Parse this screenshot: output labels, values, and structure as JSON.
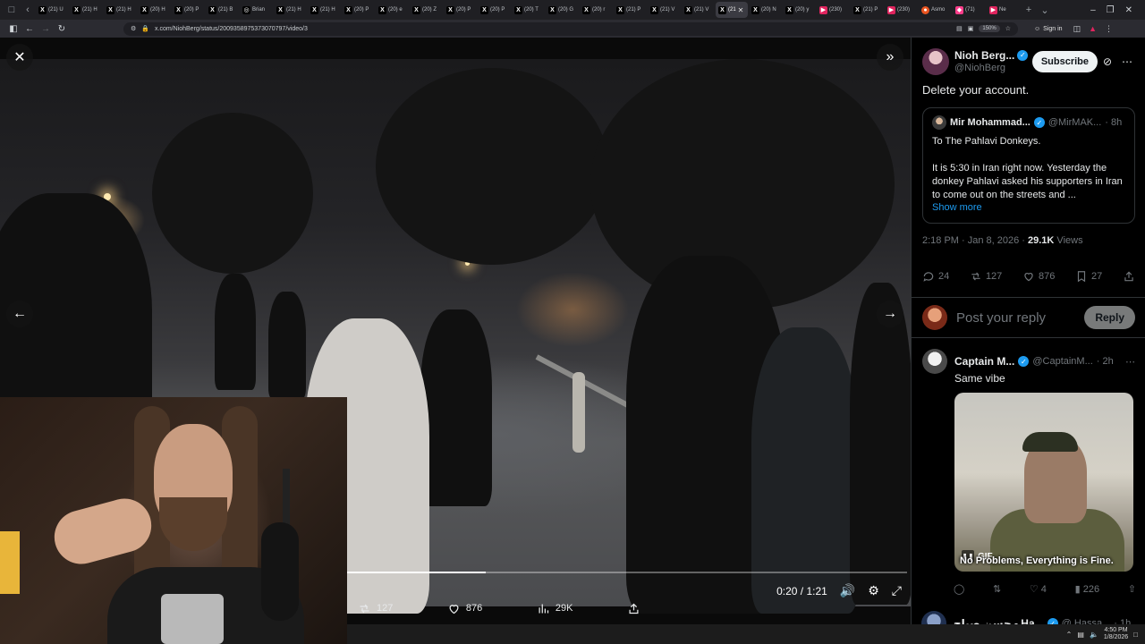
{
  "browser": {
    "tabs": [
      {
        "icon": "x-logo",
        "label": "(21) U"
      },
      {
        "icon": "x-logo",
        "label": "(21) H"
      },
      {
        "icon": "x-logo",
        "label": "(21) H"
      },
      {
        "icon": "x-logo",
        "label": "(20) H"
      },
      {
        "icon": "x-logo",
        "label": "(20) P"
      },
      {
        "icon": "x-logo",
        "label": "(21) B"
      },
      {
        "icon": "circle-logo",
        "label": "Brian"
      },
      {
        "icon": "x-logo",
        "label": "(21) H"
      },
      {
        "icon": "x-logo",
        "label": "(21) H"
      },
      {
        "icon": "x-logo",
        "label": "(20) P"
      },
      {
        "icon": "x-logo",
        "label": "(20) e"
      },
      {
        "icon": "x-logo",
        "label": "(20) Z"
      },
      {
        "icon": "x-logo",
        "label": "(20) P"
      },
      {
        "icon": "x-logo",
        "label": "(20) P"
      },
      {
        "icon": "x-logo",
        "label": "(20) T"
      },
      {
        "icon": "x-logo",
        "label": "(20) G"
      },
      {
        "icon": "x-logo",
        "label": "(20) r"
      },
      {
        "icon": "x-logo",
        "label": "(21) P"
      },
      {
        "icon": "x-logo",
        "label": "(21) V"
      },
      {
        "icon": "x-logo",
        "label": "(21) V"
      },
      {
        "icon": "x-logo",
        "label": "(21",
        "active": true
      },
      {
        "icon": "x-logo",
        "label": "(20) N"
      },
      {
        "icon": "x-logo",
        "label": "(20) y"
      },
      {
        "icon": "youtube-logo",
        "label": "(230)"
      },
      {
        "icon": "x-logo",
        "label": "(21) P"
      },
      {
        "icon": "youtube-logo",
        "label": "(230)"
      },
      {
        "icon": "reddit-logo",
        "label": "Asmo"
      },
      {
        "icon": "pink-logo",
        "label": "(71)"
      },
      {
        "icon": "youtube-logo",
        "label": "Ne"
      }
    ],
    "new_tab": "+",
    "url": "x.com/NiohBerg/status/2009358975373070797/video/3",
    "zoom": "150%",
    "signin": "Sign in"
  },
  "viewer": {
    "time_current": "0:20",
    "time_sep": " / ",
    "time_total": "1:21",
    "progress": 0.247,
    "actions": {
      "retweets": "127",
      "likes": "876",
      "views": "29K"
    }
  },
  "post": {
    "author_name": "Nioh Berg...",
    "author_handle": "@NiohBerg",
    "subscribe_label": "Subscribe",
    "text": "Delete your account.",
    "quote": {
      "name": "Mir Mohammad...",
      "handle": "@MirMAK...",
      "time": "· 8h",
      "title": "To The Pahlavi Donkeys.",
      "body": "It is 5:30 in Iran right now. Yesterday the donkey Pahlavi asked his supporters in Iran to come out on the streets and ...",
      "show_more": "Show more"
    },
    "timestamp": "2:18 PM · Jan 8, 2026 · ",
    "views_count": "29.1K",
    "views_label": " Views",
    "stats": {
      "replies": "24",
      "retweets": "127",
      "likes": "876",
      "bookmarks": "27"
    }
  },
  "reply_compose": {
    "placeholder": "Post your reply",
    "button": "Reply"
  },
  "reply": {
    "name": "Captain M...",
    "handle": "@CaptainM...",
    "time": "· 2h",
    "text": "Same vibe",
    "gif_badge": "GIF",
    "gif_caption": "No Problems, Everything is Fine.",
    "stats": {
      "retweets": "",
      "likes": "4",
      "views": "226"
    }
  },
  "next_reply": {
    "name": "حسن صباح - Ha...",
    "handle": "@ Hassa...",
    "time": "· 1h"
  },
  "taskbar": {
    "time": "4:50 PM",
    "date": "1/8/2026"
  }
}
